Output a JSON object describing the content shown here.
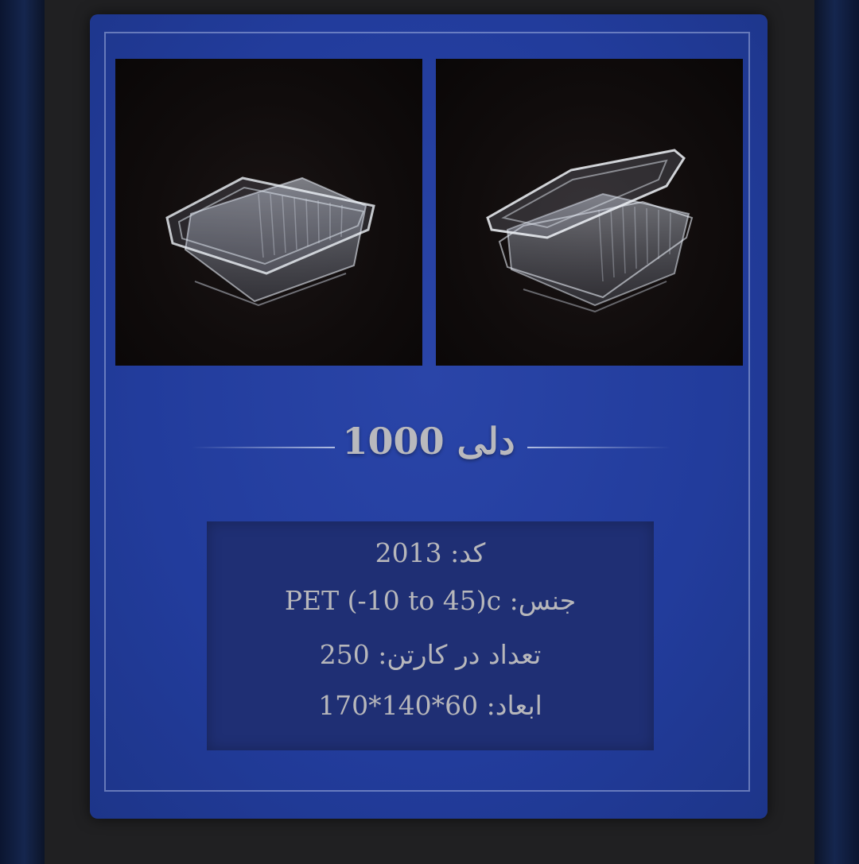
{
  "product": {
    "title": "دلی 1000"
  },
  "specs": {
    "code_label": "کد:",
    "code_value": "2013",
    "material_label": "جنس:",
    "material_value": "PET (-10 to 45)c",
    "count_label": "تعداد در کارتن:",
    "count_value": "250",
    "dims_label": "ابعاد:",
    "dims_value": "170*140*60"
  },
  "colors": {
    "card_blue": "#223c9c",
    "spec_box": "#1f2f74",
    "text": "#b7b7bb"
  }
}
